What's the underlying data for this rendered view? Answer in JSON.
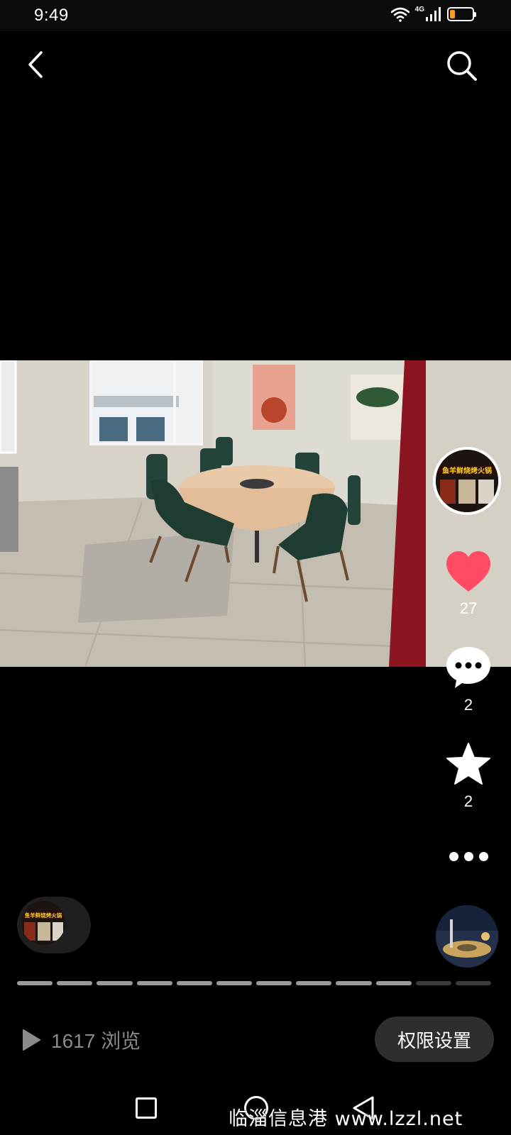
{
  "status_bar": {
    "time": "9:49",
    "network": "4G",
    "battery_level": 0.22,
    "battery_color": "#f59a23"
  },
  "nav": {
    "back_icon": "chevron-left-icon",
    "search_icon": "search-icon"
  },
  "post": {
    "author_avatar": "restaurant-storefront-avatar",
    "author_avatar_sign_text": "鱼羊鲜烧烤火锅",
    "likes": "27",
    "comments": "2",
    "favorites": "2",
    "like_color": "#ff4b63"
  },
  "gallery": {
    "total_images": 12,
    "current_index": 10
  },
  "footer": {
    "views": "1617 浏览",
    "permission_button": "权限设置"
  },
  "watermark": "临淄信息港 www.lzzl.net"
}
